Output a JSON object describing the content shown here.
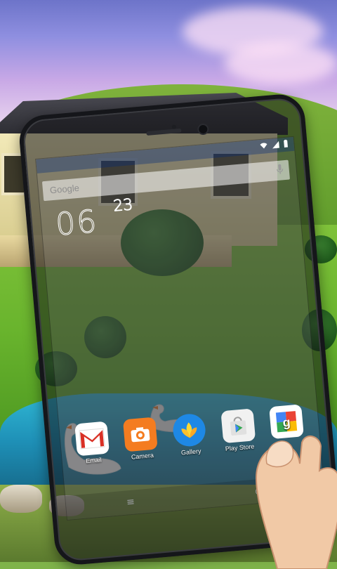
{
  "home": {
    "search_label": "Google",
    "clock": {
      "hour": "06",
      "minute": "23"
    },
    "apps": [
      {
        "label": "Email"
      },
      {
        "label": "Camera"
      },
      {
        "label": "Gallery"
      },
      {
        "label": "Play Store"
      },
      {
        "label": ""
      }
    ],
    "nav": {
      "menu_glyph": "≡",
      "home_glyph": "○"
    }
  },
  "colors": {
    "gmail_red": "#d93025",
    "camera_orange": "#f47c20",
    "gallery_blue": "#1e88e5",
    "play_green": "#34a853",
    "google_blue": "#4285f4"
  },
  "icons": [
    "wifi-icon",
    "signal-icon",
    "battery-icon",
    "mic-icon",
    "gmail-icon",
    "camera-icon",
    "gallery-icon",
    "play-store-icon",
    "google-icon",
    "menu-icon",
    "home-icon"
  ]
}
